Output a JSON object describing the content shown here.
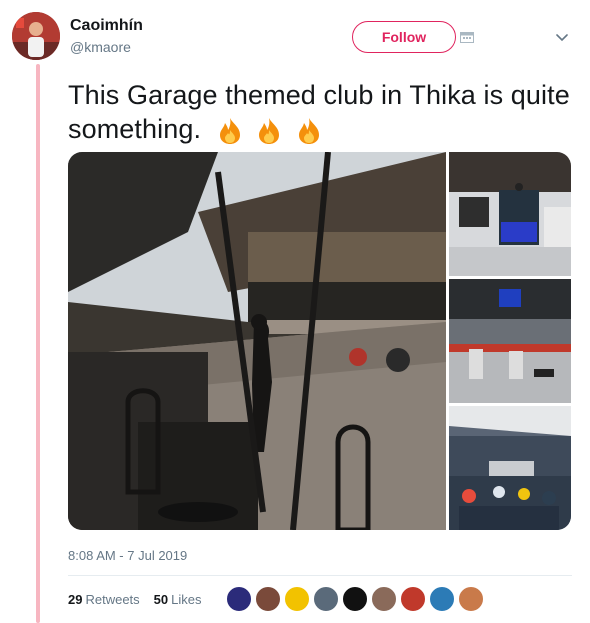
{
  "tweet": {
    "author": {
      "display_name": "Caoimhín",
      "handle": "@kmaore"
    },
    "follow_label": "Follow",
    "text": "This Garage themed club in Thika is quite something.",
    "emojis": [
      "fire",
      "fire",
      "fire"
    ],
    "timestamp": "8:08 AM - 7 Jul 2019",
    "stats": {
      "retweets_count": "29",
      "retweets_label": "Retweets",
      "likes_count": "50",
      "likes_label": "Likes"
    },
    "media_count": 4
  },
  "colors": {
    "accent": "#e0245e",
    "thread_line": "#f7b6c1",
    "secondary_text": "#657786"
  },
  "likers": [
    {
      "color": "#2b2b7a"
    },
    {
      "color": "#7a4a3a"
    },
    {
      "color": "#f2c200"
    },
    {
      "color": "#5a6a7a"
    },
    {
      "color": "#111111"
    },
    {
      "color": "#8a6a5a"
    },
    {
      "color": "#c0392b"
    },
    {
      "color": "#2c7bb6"
    },
    {
      "color": "#c97a4a"
    }
  ]
}
